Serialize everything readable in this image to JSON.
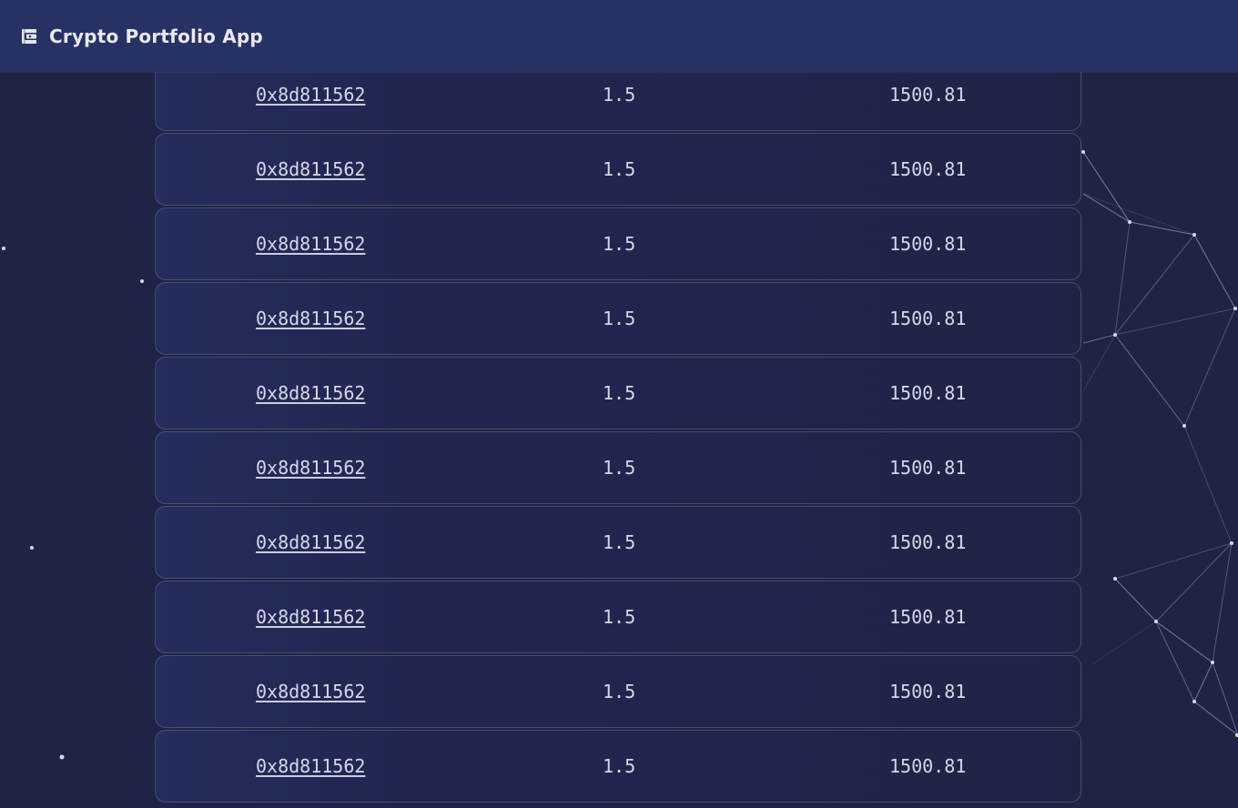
{
  "app": {
    "title": "Crypto Portfolio App",
    "icon": "wallet-icon"
  },
  "holdings": [
    {
      "address": "0x8d811562",
      "amount": "1.5",
      "value": "1500.81"
    },
    {
      "address": "0x8d811562",
      "amount": "1.5",
      "value": "1500.81"
    },
    {
      "address": "0x8d811562",
      "amount": "1.5",
      "value": "1500.81"
    },
    {
      "address": "0x8d811562",
      "amount": "1.5",
      "value": "1500.81"
    },
    {
      "address": "0x8d811562",
      "amount": "1.5",
      "value": "1500.81"
    },
    {
      "address": "0x8d811562",
      "amount": "1.5",
      "value": "1500.81"
    },
    {
      "address": "0x8d811562",
      "amount": "1.5",
      "value": "1500.81"
    },
    {
      "address": "0x8d811562",
      "amount": "1.5",
      "value": "1500.81"
    },
    {
      "address": "0x8d811562",
      "amount": "1.5",
      "value": "1500.81"
    },
    {
      "address": "0x8d811562",
      "amount": "1.5",
      "value": "1500.81"
    }
  ],
  "colors": {
    "background": "#1f2446",
    "header": "#283163",
    "text": "#d4d8ec"
  }
}
